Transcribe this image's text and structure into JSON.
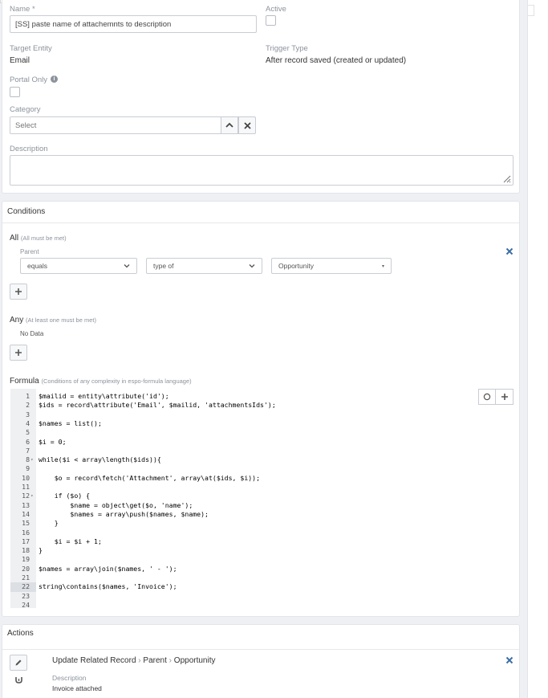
{
  "form": {
    "name_label": "Name *",
    "name_value": "[SS] paste name of attachemnts to description",
    "active_label": "Active",
    "target_entity_label": "Target Entity",
    "target_entity_value": "Email",
    "trigger_type_label": "Trigger Type",
    "trigger_type_value": "After record saved (created or updated)",
    "portal_only_label": "Portal Only",
    "category_label": "Category",
    "category_placeholder": "Select",
    "description_label": "Description"
  },
  "conditions": {
    "title": "Conditions",
    "all_label": "All",
    "all_hint": "(All must be met)",
    "parent_label": "Parent",
    "operator_value": "equals",
    "type_value": "type of",
    "entity_value": "Opportunity",
    "any_label": "Any",
    "any_hint": "(At least one must be met)",
    "no_data": "No Data",
    "formula_label": "Formula",
    "formula_hint": "(Conditions of any complexity in espo-formula language)"
  },
  "formula_lines": [
    "$mailid = entity\\attribute('id');",
    "$ids = record\\attribute('Email', $mailid, 'attachmentsIds');",
    "",
    "$names = list();",
    "",
    "$i = 0;",
    "",
    "while($i < array\\length($ids)){",
    "",
    "    $o = record\\fetch('Attachment', array\\at($ids, $i));",
    "",
    "    if ($o) {",
    "        $name = object\\get($o, 'name');",
    "        $names = array\\push($names, $name);",
    "    }",
    "",
    "    $i = $i + 1;",
    "}",
    "",
    "$names = array\\join($names, ' - ');",
    "",
    "string\\contains($names, 'Invoice');",
    "",
    ""
  ],
  "actions": {
    "title": "Actions",
    "action_title": "Update Related Record",
    "action_sep": "›",
    "action_link": "Parent",
    "action_entity": "Opportunity",
    "description_label": "Description",
    "description_value": "Invoice attached"
  },
  "icons": {
    "info": "info-icon",
    "chevron_up": "chevron-up-icon",
    "clear": "close-icon",
    "add": "plus-icon",
    "circle": "circle-icon",
    "edit": "pencil-icon",
    "move": "move-down-icon",
    "resize": "resize-icon"
  }
}
